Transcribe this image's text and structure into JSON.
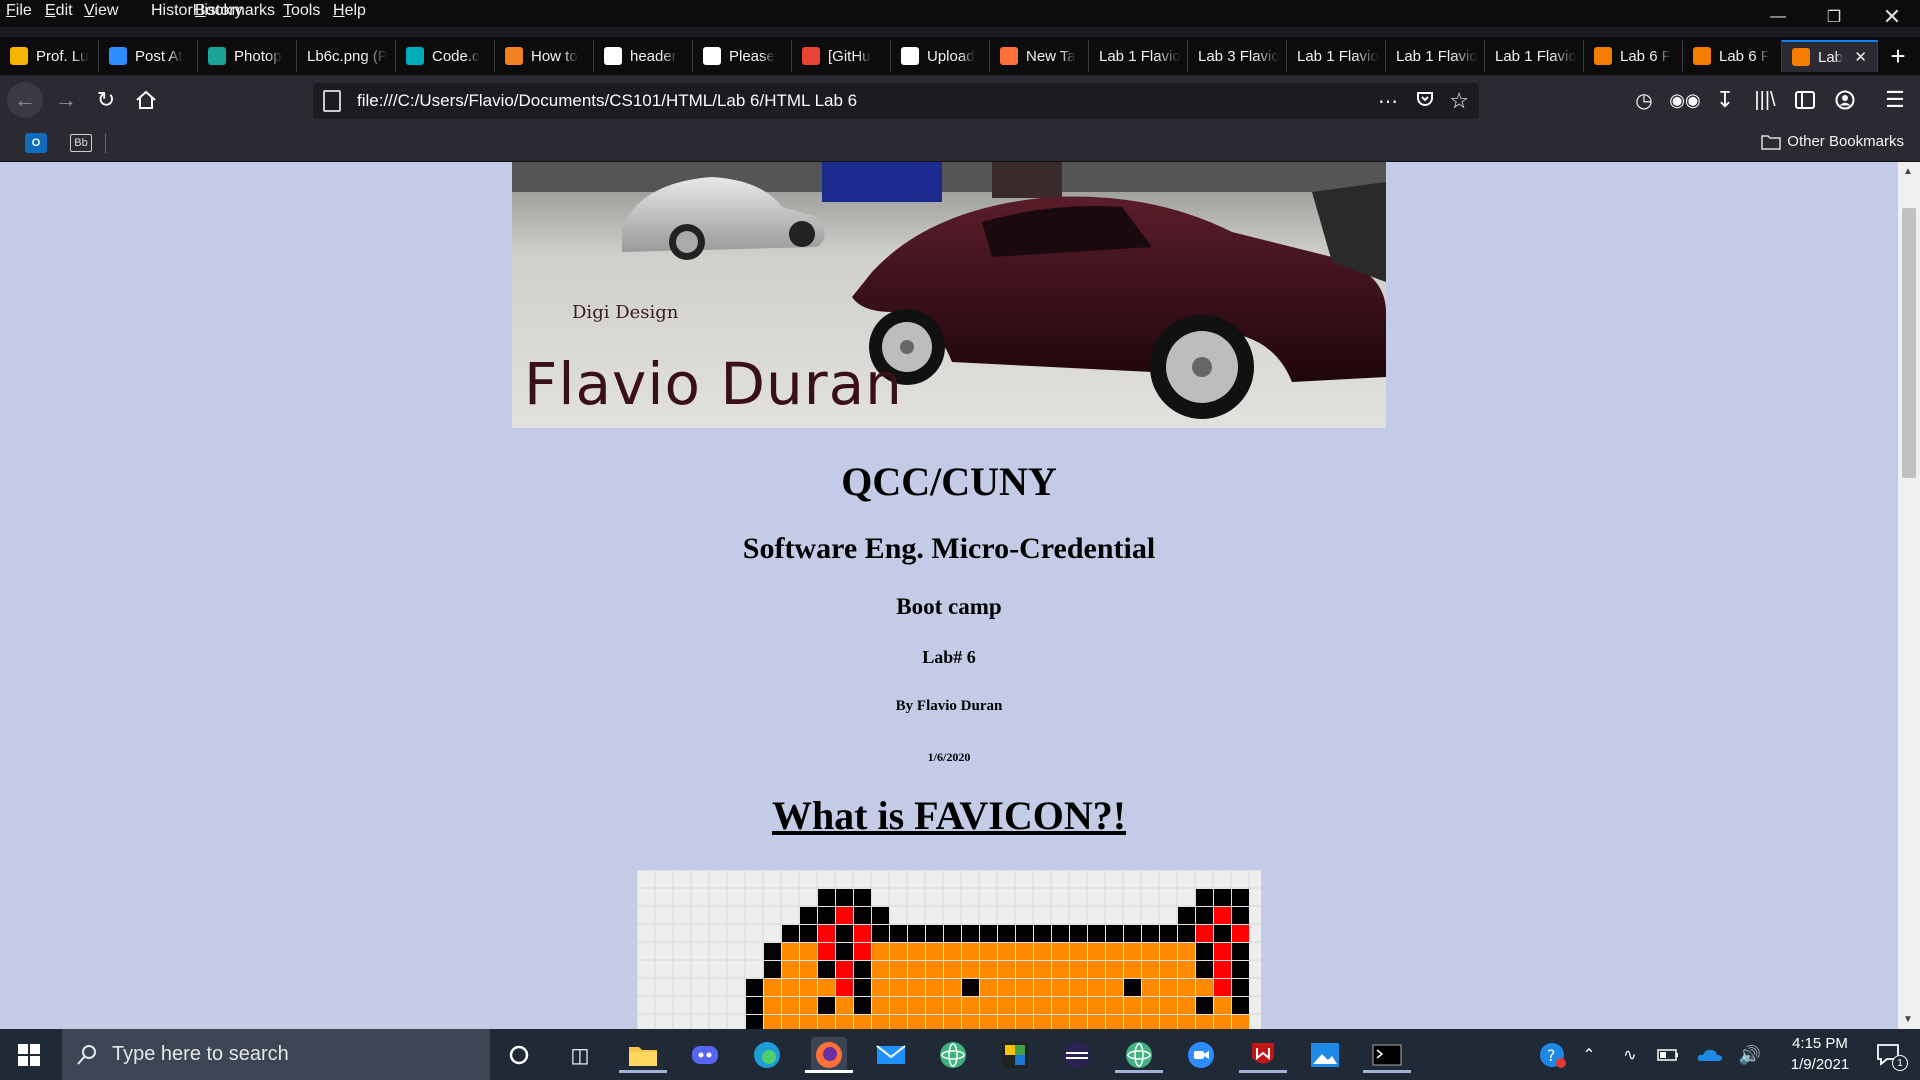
{
  "menu": [
    "File",
    "Edit",
    "View",
    "History",
    "Bookmarks",
    "Tools",
    "Help"
  ],
  "menu_access": [
    "F",
    "E",
    "V",
    "S",
    "B",
    "T",
    "H"
  ],
  "window_controls": [
    "minimize-icon",
    "restore-icon",
    "close-icon"
  ],
  "tabs": [
    {
      "label": "Prof. Lu",
      "icon": "blackboard-icon",
      "color": "#f4b400"
    },
    {
      "label": "Post At",
      "icon": "zoom-icon",
      "color": "#2d8cff"
    },
    {
      "label": "Photop",
      "icon": "photopea-icon",
      "color": "#18a497"
    },
    {
      "label": "Lb6c.png (P",
      "icon": "none",
      "color": ""
    },
    {
      "label": "Code.o",
      "icon": "code-org-icon",
      "color": "#00adbc"
    },
    {
      "label": "How to",
      "icon": "stackoverflow-icon",
      "color": "#f48024"
    },
    {
      "label": "header",
      "icon": "google-icon",
      "color": "#ffffff"
    },
    {
      "label": "Please",
      "icon": "github-icon",
      "color": "#ffffff"
    },
    {
      "label": "[GitHu",
      "icon": "gmail-icon",
      "color": "#ea4335"
    },
    {
      "label": "Upload",
      "icon": "github-icon",
      "color": "#ffffff"
    },
    {
      "label": "New Ta",
      "icon": "firefox-icon",
      "color": "#ff7139"
    },
    {
      "label": "Lab 1 Flavio",
      "icon": "none",
      "color": ""
    },
    {
      "label": "Lab 3 Flavio",
      "icon": "none",
      "color": ""
    },
    {
      "label": "Lab 1 Flavio",
      "icon": "none",
      "color": ""
    },
    {
      "label": "Lab 1 Flavio",
      "icon": "none",
      "color": ""
    },
    {
      "label": "Lab 1 Flavio",
      "icon": "none",
      "color": ""
    },
    {
      "label": "Lab 6 F",
      "icon": "cat-favicon-icon",
      "color": "#f57c00"
    },
    {
      "label": "Lab 6 F",
      "icon": "cat-favicon-icon",
      "color": "#f57c00"
    },
    {
      "label": "Lab",
      "icon": "cat-favicon-icon",
      "color": "#f57c00",
      "active": true
    }
  ],
  "url": "file:///C:/Users/Flavio/Documents/CS101/HTML/Lab 6/HTML Lab 6",
  "bookmarks_right": "Other Bookmarks",
  "page": {
    "banner_subtitle": "Digi Design",
    "banner_name": "Flavio Duran",
    "h1": "QCC/CUNY",
    "h2": "Software Eng. Micro-Credential",
    "h3": "Boot camp",
    "h4": "Lab# 6",
    "h5": "By Flavio Duran",
    "h6": "1/6/2020",
    "section_title": "What is FAVICON?!"
  },
  "taskbar": {
    "search_placeholder": "Type here to search",
    "time": "4:15 PM",
    "date": "1/9/2021",
    "notification_count": "1"
  },
  "colors": {
    "page_bg": "#c3cbe6",
    "cat_orange": "#ff8a00",
    "cat_red": "#ff0000",
    "cat_black": "#000000"
  }
}
